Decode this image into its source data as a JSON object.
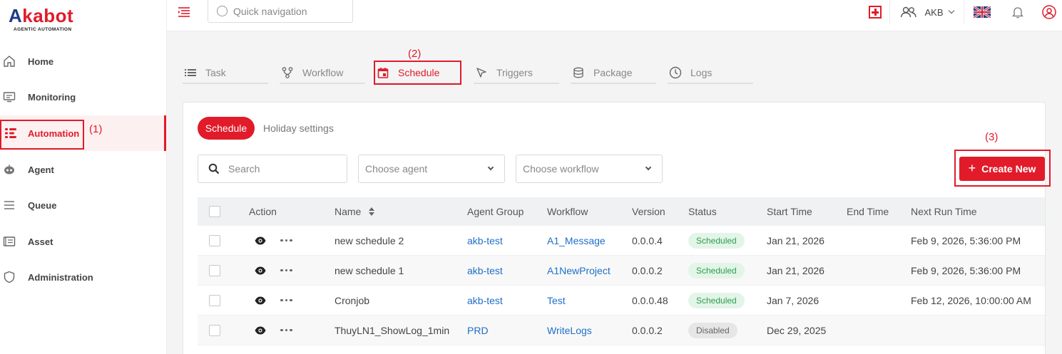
{
  "brand": {
    "logo_main": "Akabot",
    "logo_sub": "AGENTIC AUTOMATION",
    "accent": "#e11b2a",
    "link_color": "#1f6fc9"
  },
  "sidebar": {
    "items": [
      {
        "label": "Home",
        "icon": "home-icon"
      },
      {
        "label": "Monitoring",
        "icon": "monitor-icon"
      },
      {
        "label": "Automation",
        "icon": "automation-icon",
        "active": true
      },
      {
        "label": "Agent",
        "icon": "robot-icon"
      },
      {
        "label": "Queue",
        "icon": "queue-icon"
      },
      {
        "label": "Asset",
        "icon": "asset-icon"
      },
      {
        "label": "Administration",
        "icon": "shield-icon"
      }
    ]
  },
  "topbar": {
    "quick_nav_placeholder": "Quick navigation",
    "user_label": "AKB",
    "language_flag": "uk-flag-icon"
  },
  "annotations": {
    "a1": "(1)",
    "a2": "(2)",
    "a3": "(3)"
  },
  "tabs": [
    {
      "label": "Task",
      "icon": "list-icon"
    },
    {
      "label": "Workflow",
      "icon": "workflow-icon"
    },
    {
      "label": "Schedule",
      "icon": "calendar-icon",
      "active": true
    },
    {
      "label": "Triggers",
      "icon": "cursor-icon"
    },
    {
      "label": "Package",
      "icon": "database-icon"
    },
    {
      "label": "Logs",
      "icon": "clock-icon"
    }
  ],
  "subtabs": {
    "schedule": "Schedule",
    "holiday": "Holiday settings"
  },
  "filters": {
    "search_placeholder": "Search",
    "agent_placeholder": "Choose agent",
    "workflow_placeholder": "Choose workflow"
  },
  "create_button": "Create New",
  "table": {
    "headers": {
      "action": "Action",
      "name": "Name",
      "agent_group": "Agent Group",
      "workflow": "Workflow",
      "version": "Version",
      "status": "Status",
      "start_time": "Start Time",
      "end_time": "End Time",
      "next_run": "Next Run Time"
    },
    "rows": [
      {
        "name": "new schedule 2",
        "agent_group": "akb-test",
        "workflow": "A1_Message",
        "version": "0.0.0.4",
        "status": "Scheduled",
        "start_time": "Jan 21, 2026",
        "end_time": "",
        "next_run": "Feb 9, 2026, 5:36:00 PM"
      },
      {
        "name": "new schedule 1",
        "agent_group": "akb-test",
        "workflow": "A1NewProject",
        "version": "0.0.0.2",
        "status": "Scheduled",
        "start_time": "Jan 21, 2026",
        "end_time": "",
        "next_run": "Feb 9, 2026, 5:36:00 PM"
      },
      {
        "name": "Cronjob",
        "agent_group": "akb-test",
        "workflow": "Test",
        "version": "0.0.0.48",
        "status": "Scheduled",
        "start_time": "Jan 7, 2026",
        "end_time": "",
        "next_run": "Feb 12, 2026, 10:00:00 AM"
      },
      {
        "name": "ThuyLN1_ShowLog_1min",
        "agent_group": "PRD",
        "workflow": "WriteLogs",
        "version": "0.0.0.2",
        "status": "Disabled",
        "start_time": "Dec 29, 2025",
        "end_time": "",
        "next_run": ""
      }
    ]
  }
}
